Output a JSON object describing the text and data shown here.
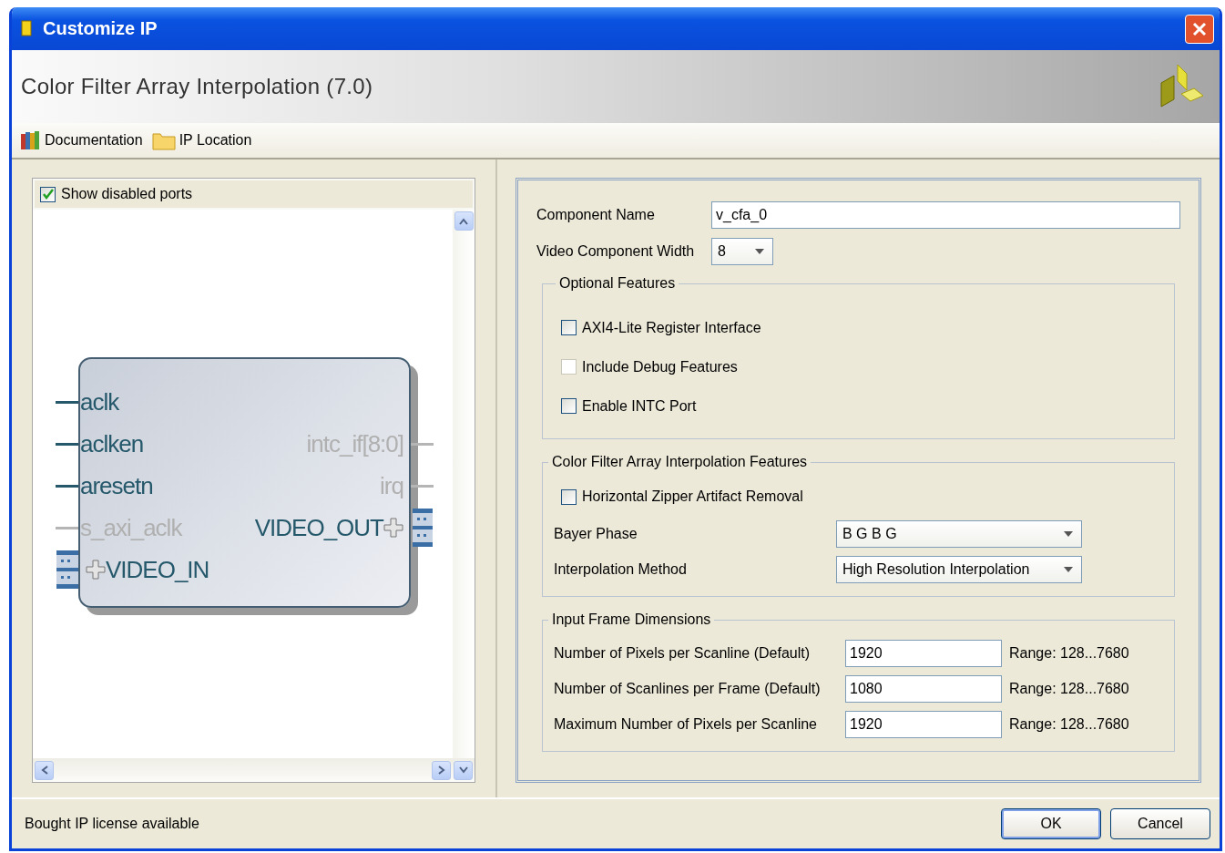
{
  "window": {
    "title": "Customize IP"
  },
  "header": {
    "title": "Color Filter Array Interpolation (7.0)"
  },
  "toolbar": [
    {
      "label": "Documentation",
      "kind": "books"
    },
    {
      "label": "IP Location",
      "kind": "folder"
    }
  ],
  "symbol": {
    "show_disabled": {
      "label": "Show disabled ports",
      "checked": true
    },
    "left_ports": [
      {
        "name": "aclk",
        "enabled": true,
        "kind": "wire"
      },
      {
        "name": "aclken",
        "enabled": true,
        "kind": "wire"
      },
      {
        "name": "aresetn",
        "enabled": true,
        "kind": "wire"
      },
      {
        "name": "s_axi_aclk",
        "enabled": false,
        "kind": "wire"
      },
      {
        "name": "VIDEO_IN",
        "enabled": true,
        "kind": "bus"
      }
    ],
    "right_ports": [
      {
        "name": "intc_if[8:0]",
        "enabled": false,
        "kind": "wire"
      },
      {
        "name": "irq",
        "enabled": false,
        "kind": "wire"
      },
      {
        "name": "VIDEO_OUT",
        "enabled": true,
        "kind": "bus"
      }
    ]
  },
  "component_name": {
    "label": "Component Name",
    "value": "v_cfa_0"
  },
  "video_width": {
    "label": "Video Component Width",
    "value": "8"
  },
  "optional_features": {
    "title": "Optional Features",
    "options": [
      {
        "label": "AXI4-Lite Register Interface",
        "checked": false,
        "disabled": false
      },
      {
        "label": "Include Debug Features",
        "checked": false,
        "disabled": true
      },
      {
        "label": "Enable INTC Port",
        "checked": false,
        "disabled": false
      }
    ]
  },
  "cfa_features": {
    "title": "Color Filter Array Interpolation Features",
    "options": [
      {
        "label": "Horizontal Zipper Artifact Removal",
        "checked": false
      }
    ],
    "selects": [
      {
        "label": "Bayer Phase",
        "value": "B G B G"
      },
      {
        "label": "Interpolation Method",
        "value": "High Resolution Interpolation"
      }
    ]
  },
  "frame_dimensions": {
    "title": "Input Frame Dimensions",
    "rows": [
      {
        "label": "Number of Pixels per Scanline (Default)",
        "value": "1920",
        "range": "Range: 128...7680"
      },
      {
        "label": "Number of Scanlines per Frame (Default)",
        "value": "1080",
        "range": "Range: 128...7680"
      },
      {
        "label": "Maximum Number of Pixels per Scanline",
        "value": "1920",
        "range": "Range: 128...7680"
      }
    ]
  },
  "status": "Bought IP license available",
  "buttons": [
    {
      "label": "OK",
      "default": true
    },
    {
      "label": "Cancel",
      "default": false
    }
  ]
}
